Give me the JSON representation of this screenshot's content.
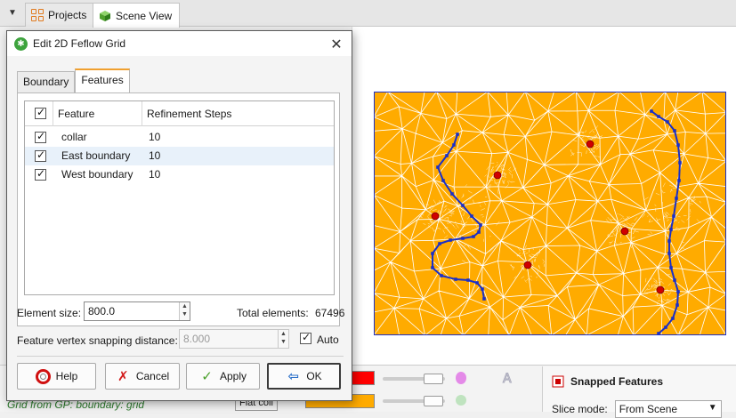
{
  "app": {
    "tabs": [
      {
        "label": "Projects",
        "icon": "projects-grid-icon"
      },
      {
        "label": "Scene View",
        "icon": "cube-icon"
      }
    ],
    "right_panel": {
      "title": "Snapped Features",
      "slice_mode_label": "Slice mode:",
      "slice_mode_value": "From Scene"
    },
    "tree_item": "Grid from GP: boundary: grid",
    "chip_label": "Flat coll"
  },
  "dialog": {
    "title": "Edit 2D Feflow Grid",
    "tabs": [
      {
        "label": "Boundary",
        "active": false
      },
      {
        "label": "Features",
        "active": true
      }
    ],
    "table": {
      "columns": [
        "Feature",
        "Refinement Steps"
      ],
      "rows": [
        {
          "feature": "collar",
          "steps": "10",
          "checked": true
        },
        {
          "feature": "East boundary",
          "steps": "10",
          "checked": true
        },
        {
          "feature": "West boundary",
          "steps": "10",
          "checked": true
        }
      ]
    },
    "element_size_label": "Element size:",
    "element_size_value": "800.0",
    "total_elements_label": "Total elements:",
    "total_elements_value": "67496",
    "snap_label": "Feature vertex snapping distance:",
    "snap_value": "8.000",
    "auto_label": "Auto",
    "buttons": {
      "help": "Help",
      "cancel": "Cancel",
      "apply": "Apply",
      "ok": "OK"
    }
  },
  "colors": {
    "mesh_fill": "#ffab00",
    "feature_line": "#1a2fc8",
    "point_marker": "#d00000",
    "swatch_red": "#ff0000",
    "swatch_orange": "#ffab00"
  }
}
